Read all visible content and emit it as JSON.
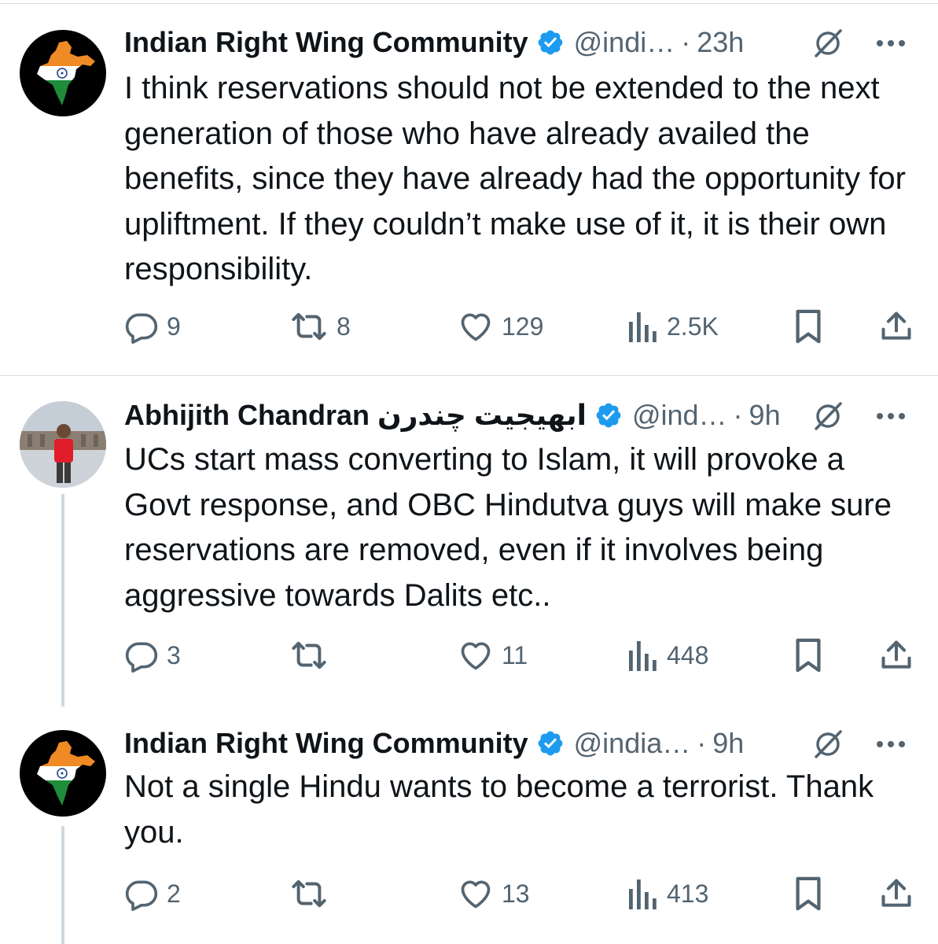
{
  "tweets": [
    {
      "author": "Indian Right Wing Community",
      "handle": "@indi…",
      "time": "23h",
      "text": "I think reservations should not be extended to the next generation of those who have already availed the benefits, since they have already had the opportunity for upliftment. If they couldn’t make use of it, it is their own responsibility.",
      "replies": "9",
      "reposts": "8",
      "likes": "129",
      "views": "2.5K"
    },
    {
      "author": "Abhijith Chandran ابھیجیت چندرن",
      "handle": "@ind…",
      "time": "9h",
      "text": "UCs start mass converting to Islam, it will provoke a Govt response, and OBC Hindutva guys will make sure reservations are removed, even if it involves being aggressive towards Dalits etc..",
      "replies": "3",
      "reposts": "",
      "likes": "11",
      "views": "448"
    },
    {
      "author": "Indian Right Wing Community",
      "handle": "@india…",
      "time": "9h",
      "text": "Not a single Hindu wants to become a terrorist. Thank you.",
      "replies": "2",
      "reposts": "",
      "likes": "13",
      "views": "413"
    }
  ],
  "separator": "·",
  "icons": {
    "reply": "reply-icon",
    "repost": "repost-icon",
    "like": "heart-icon",
    "views": "views-icon",
    "bookmark": "bookmark-icon",
    "share": "share-icon",
    "grok": "grok-icon",
    "more": "more-icon",
    "verified": "verified-badge-icon"
  },
  "colors": {
    "verified": "#1d9bf0",
    "text": "#0f1419",
    "secondary": "#536471",
    "divider": "#d9dde0",
    "thread_line": "#cfd9de"
  }
}
